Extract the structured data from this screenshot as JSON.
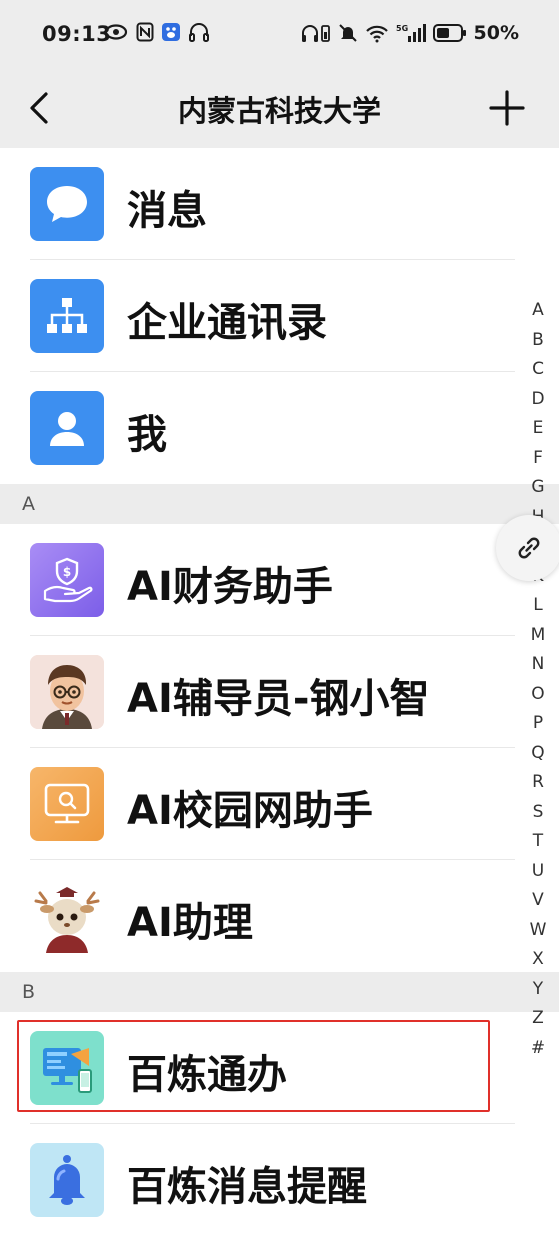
{
  "status_bar": {
    "time": "09:13",
    "battery": "50%",
    "network": "5G"
  },
  "nav": {
    "title": "内蒙古科技大学",
    "back_icon": "chevron-left-icon",
    "add_icon": "plus-icon"
  },
  "top_items": [
    {
      "label": "消息",
      "icon": "chat-bubble-icon",
      "color": "#3d8ff0"
    },
    {
      "label": "企业通讯录",
      "icon": "org-chart-icon",
      "color": "#3d8ff0"
    },
    {
      "label": "我",
      "icon": "person-icon",
      "color": "#3d8ff0"
    }
  ],
  "sections": [
    {
      "letter": "A",
      "items": [
        {
          "label": "AI财务助手",
          "icon": "finance-hand-icon"
        },
        {
          "label": "AI辅导员-钢小智",
          "icon": "cartoon-boy-avatar"
        },
        {
          "label": "AI校园网助手",
          "icon": "monitor-search-icon"
        },
        {
          "label": "AI助理",
          "icon": "deer-mascot-avatar"
        }
      ]
    },
    {
      "letter": "B",
      "items": [
        {
          "label": "百炼通办",
          "icon": "screen-flag-icon"
        },
        {
          "label": "百炼消息提醒",
          "icon": "bell-icon"
        }
      ]
    }
  ],
  "alphabet": [
    "A",
    "B",
    "C",
    "D",
    "E",
    "F",
    "G",
    "H",
    "",
    "K",
    "L",
    "M",
    "N",
    "O",
    "P",
    "Q",
    "R",
    "S",
    "T",
    "U",
    "V",
    "W",
    "X",
    "Y",
    "Z",
    "#"
  ],
  "colors": {
    "accent": "#3d8ff0",
    "highlight": "#e0302a",
    "section_bg": "#ececec"
  }
}
